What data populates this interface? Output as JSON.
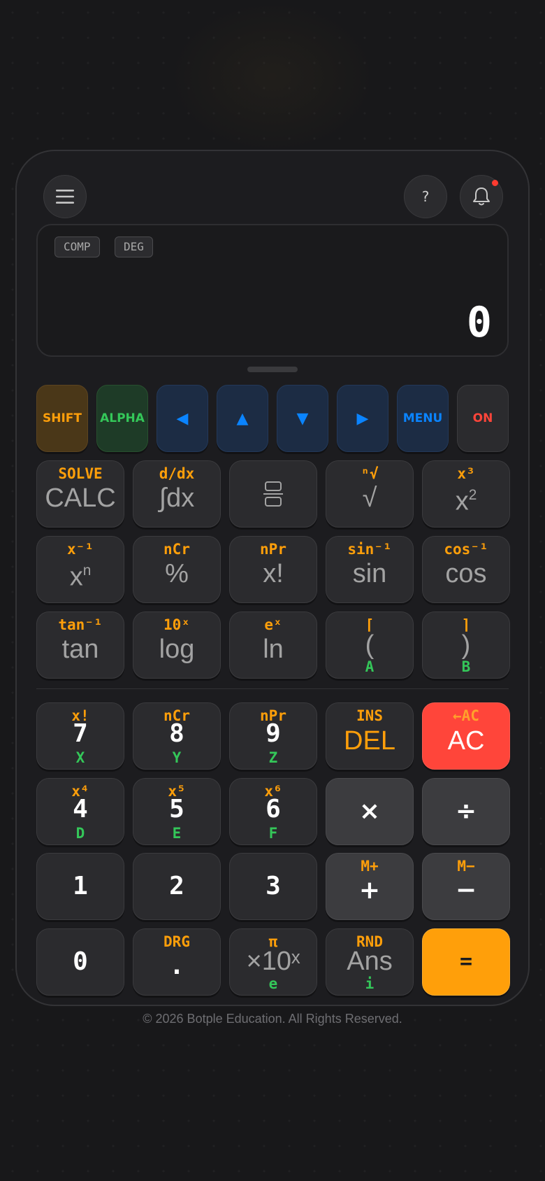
{
  "display": {
    "mode": "COMP",
    "angle": "DEG",
    "value": "0"
  },
  "header": {
    "help_label": "?"
  },
  "nav_row": [
    {
      "label": "SHIFT"
    },
    {
      "label": "ALPHA"
    },
    {
      "label": "◀"
    },
    {
      "label": "▲"
    },
    {
      "label": "▼"
    },
    {
      "label": "▶"
    },
    {
      "label": "MENU"
    },
    {
      "label": "ON"
    }
  ],
  "function_keys": {
    "calc": {
      "secondary": "SOLVE",
      "main": "CALC"
    },
    "integ": {
      "secondary": "d/dx",
      "main": "∫dx"
    },
    "root": {
      "secondary": "ⁿ√",
      "main": "√"
    },
    "sq": {
      "secondary": "x³",
      "main": "x",
      "sup": "2"
    },
    "pow": {
      "secondary": "x⁻¹",
      "main": "x",
      "sup": "n"
    },
    "pct": {
      "secondary": "nCr",
      "main": "%"
    },
    "fact": {
      "secondary": "nPr",
      "main": "x!"
    },
    "sin": {
      "secondary": "sin⁻¹",
      "main": "sin"
    },
    "cos": {
      "secondary": "cos⁻¹",
      "main": "cos"
    },
    "tan": {
      "secondary": "tan⁻¹",
      "main": "tan"
    },
    "log": {
      "secondary": "10ˣ",
      "main": "log"
    },
    "ln": {
      "secondary": "eˣ",
      "main": "ln"
    },
    "lparen": {
      "secondary": "⌈",
      "main": "(",
      "alpha": "A"
    },
    "rparen": {
      "secondary": "⌉",
      "main": ")",
      "alpha": "B"
    }
  },
  "number_keys": {
    "k7": {
      "secondary": "x!",
      "main": "7",
      "alpha": "X"
    },
    "k8": {
      "secondary": "nCr",
      "main": "8",
      "alpha": "Y"
    },
    "k9": {
      "secondary": "nPr",
      "main": "9",
      "alpha": "Z"
    },
    "del": {
      "secondary": "INS",
      "main": "DEL"
    },
    "ac": {
      "secondary": "←AC",
      "main": "AC"
    },
    "k4": {
      "secondary": "x⁴",
      "main": "4",
      "alpha": "D"
    },
    "k5": {
      "secondary": "x⁵",
      "main": "5",
      "alpha": "E"
    },
    "k6": {
      "secondary": "x⁶",
      "main": "6",
      "alpha": "F"
    },
    "mul": {
      "main": "×"
    },
    "div": {
      "main": "÷"
    },
    "k1": {
      "main": "1"
    },
    "k2": {
      "main": "2"
    },
    "k3": {
      "main": "3"
    },
    "add": {
      "secondary": "M+",
      "main": "+"
    },
    "sub": {
      "secondary": "M−",
      "main": "−"
    },
    "k0": {
      "main": "0"
    },
    "dot": {
      "secondary": "DRG",
      "main": "."
    },
    "exp": {
      "secondary": "π",
      "main": "×10ˣ",
      "alpha": "e"
    },
    "ans": {
      "secondary": "RND",
      "main": "Ans",
      "alpha": "i"
    },
    "eq": {
      "main": "="
    }
  },
  "footer": {
    "copyright": "© 2026 Botple Education. All Rights Reserved."
  },
  "colors": {
    "shift": "#ff9f0a",
    "alpha": "#34c759",
    "nav": "#0a84ff",
    "ac": "#ff453a",
    "equals": "#ff9f0a"
  }
}
